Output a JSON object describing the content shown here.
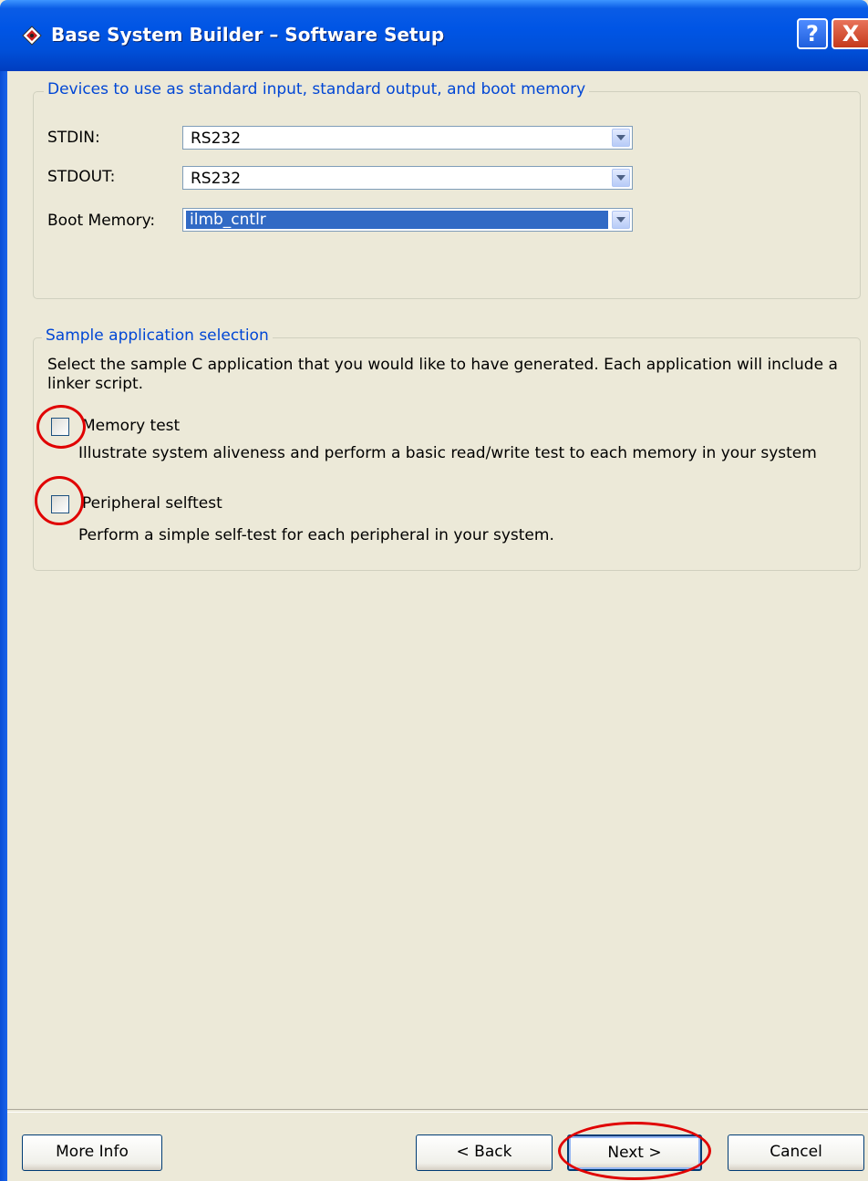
{
  "window": {
    "title": "Base System Builder – Software Setup",
    "help_icon": "?",
    "close_icon": "X"
  },
  "devices_group": {
    "legend": "Devices to use as standard input, standard output, and boot memory",
    "stdin_label": "STDIN:",
    "stdin_value": "RS232",
    "stdout_label": "STDOUT:",
    "stdout_value": "RS232",
    "boot_label": "Boot Memory:",
    "boot_value": "ilmb_cntlr"
  },
  "sample_group": {
    "legend": "Sample application selection",
    "instruction": "Select the sample C application that you would like to have generated.  Each application will include a linker script.",
    "memory_test": {
      "label": "Memory test",
      "checked": false,
      "description": "Illustrate system aliveness and perform a basic read/write test to each memory in your system"
    },
    "peripheral_test": {
      "label": "Peripheral selftest",
      "checked": false,
      "description": "Perform a simple self-test for each peripheral in your system."
    }
  },
  "footer": {
    "more_info": "More Info",
    "back": "< Back",
    "next": "Next >",
    "cancel": "Cancel"
  },
  "colors": {
    "titlebar": "#0055e5",
    "legend_text": "#0046d5",
    "highlight": "#e00000",
    "selection": "#316ac5",
    "background": "#ece9d8"
  }
}
